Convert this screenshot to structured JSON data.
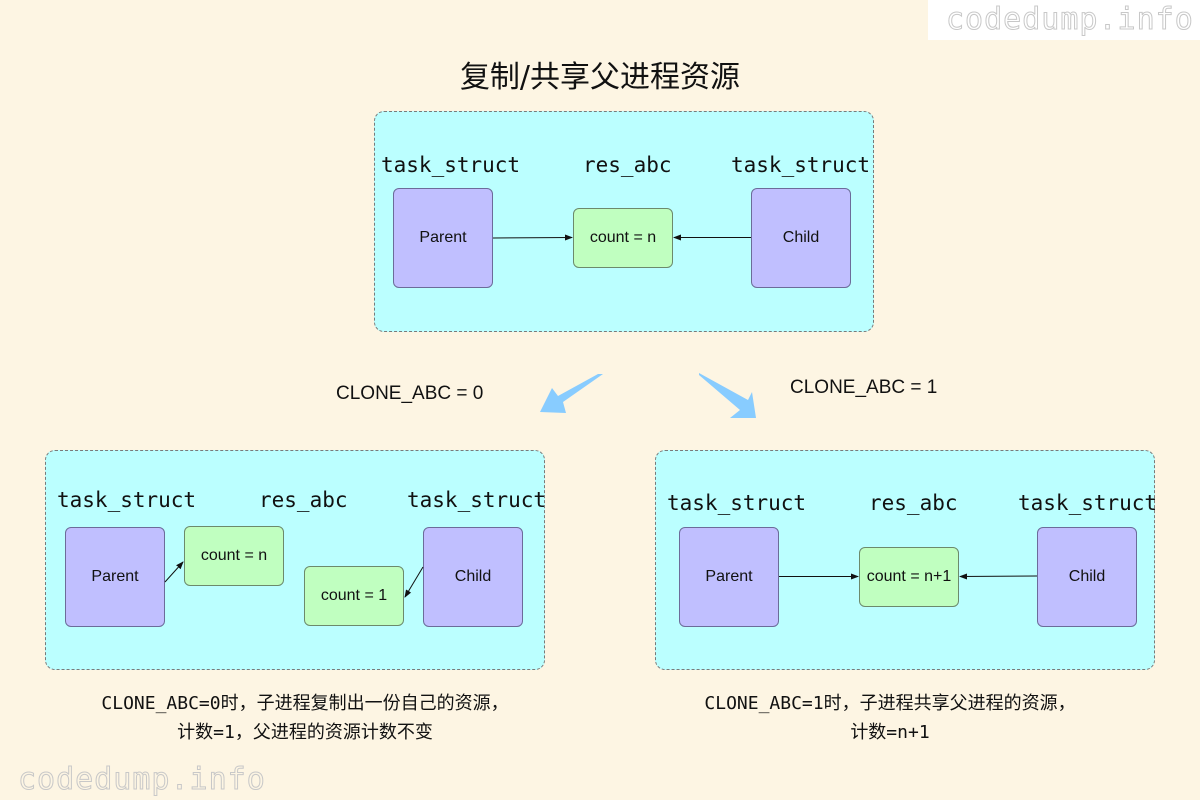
{
  "watermark": "codedump.info",
  "title": "复制/共享父进程资源",
  "top_panel": {
    "labels": {
      "left": "task_struct",
      "middle": "res_abc",
      "right": "task_struct"
    },
    "parent": "Parent",
    "child": "Child",
    "resource": "count = n"
  },
  "branches": {
    "left_label": "CLONE_ABC = 0",
    "right_label": "CLONE_ABC = 1"
  },
  "left_panel": {
    "labels": {
      "left": "task_struct",
      "middle": "res_abc",
      "right": "task_struct"
    },
    "parent": "Parent",
    "child": "Child",
    "parent_resource": "count = n",
    "child_resource": "count = 1",
    "caption_line1": "CLONE_ABC=0时，子进程复制出一份自己的资源，",
    "caption_line2": "计数=1，父进程的资源计数不变"
  },
  "right_panel": {
    "labels": {
      "left": "task_struct",
      "middle": "res_abc",
      "right": "task_struct"
    },
    "parent": "Parent",
    "child": "Child",
    "resource": "count = n+1",
    "caption_line1": "CLONE_ABC=1时，子进程共享父进程的资源，",
    "caption_line2": "计数=n+1"
  },
  "colors": {
    "background": "#fdf5e3",
    "panel": "#bbffff",
    "process_box": "#c0bfff",
    "resource_box": "#c0ffc0",
    "branch_arrow": "#88ccff"
  }
}
